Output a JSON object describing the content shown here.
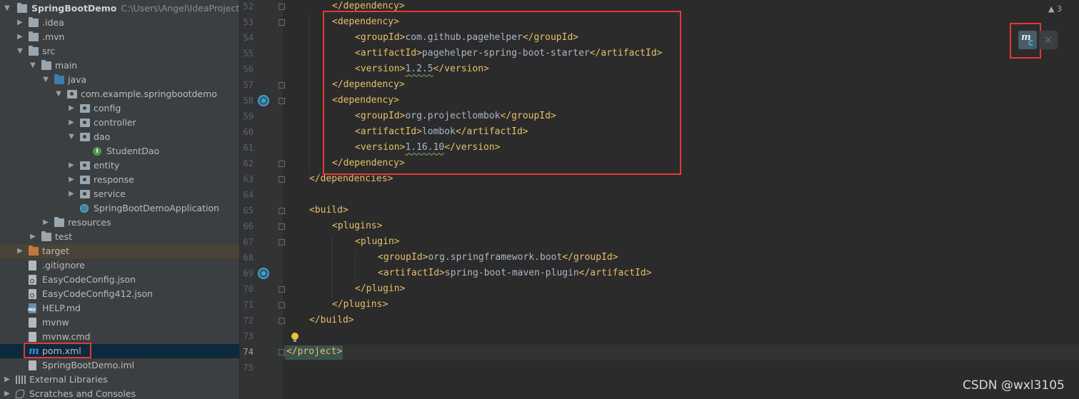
{
  "project": {
    "name": "SpringBootDemo",
    "path": "C:\\Users\\Angel\\IdeaProjects\\Sp"
  },
  "tree": [
    {
      "label": ".idea",
      "icon": "folder-icon",
      "arrow": "right"
    },
    {
      "label": ".mvn",
      "icon": "folder-icon",
      "arrow": "right"
    },
    {
      "label": "src",
      "icon": "folder-icon",
      "arrow": "down"
    },
    {
      "label": "main",
      "icon": "folder-icon",
      "arrow": "down"
    },
    {
      "label": "java",
      "icon": "source-folder-icon",
      "arrow": "down"
    },
    {
      "label": "com.example.springbootdemo",
      "icon": "package-icon",
      "arrow": "down"
    },
    {
      "label": "config",
      "icon": "package-icon",
      "arrow": "right"
    },
    {
      "label": "controller",
      "icon": "package-icon",
      "arrow": "right"
    },
    {
      "label": "dao",
      "icon": "package-icon",
      "arrow": "down"
    },
    {
      "label": "StudentDao",
      "icon": "interface-icon",
      "arrow": ""
    },
    {
      "label": "entity",
      "icon": "package-icon",
      "arrow": "right"
    },
    {
      "label": "response",
      "icon": "package-icon",
      "arrow": "right"
    },
    {
      "label": "service",
      "icon": "package-icon",
      "arrow": "right"
    },
    {
      "label": "SpringBootDemoApplication",
      "icon": "spring-class-icon",
      "arrow": ""
    },
    {
      "label": "resources",
      "icon": "resources-folder-icon",
      "arrow": "right"
    },
    {
      "label": "test",
      "icon": "folder-icon",
      "arrow": "right"
    },
    {
      "label": "target",
      "icon": "excluded-folder-icon",
      "arrow": "right"
    },
    {
      "label": ".gitignore",
      "icon": "file-icon",
      "arrow": ""
    },
    {
      "label": "EasyCodeConfig.json",
      "icon": "config-file-icon",
      "arrow": ""
    },
    {
      "label": "EasyCodeConfig412.json",
      "icon": "config-file-icon",
      "arrow": ""
    },
    {
      "label": "HELP.md",
      "icon": "markdown-file-icon",
      "arrow": ""
    },
    {
      "label": "mvnw",
      "icon": "file-icon",
      "arrow": ""
    },
    {
      "label": "mvnw.cmd",
      "icon": "file-icon",
      "arrow": ""
    },
    {
      "label": "pom.xml",
      "icon": "maven-icon",
      "arrow": ""
    },
    {
      "label": "SpringBootDemo.iml",
      "icon": "file-icon",
      "arrow": ""
    },
    {
      "label": "External Libraries",
      "icon": "libraries-icon",
      "arrow": "right"
    },
    {
      "label": "Scratches and Consoles",
      "icon": "scratches-icon",
      "arrow": "right"
    }
  ],
  "editor": {
    "lines": [
      {
        "n": "52",
        "tokens": [
          {
            "t": "tag",
            "v": "</dependency>"
          }
        ]
      },
      {
        "n": "53",
        "tokens": [
          {
            "t": "tag",
            "v": "<dependency>"
          }
        ]
      },
      {
        "n": "54",
        "tokens": [
          {
            "t": "tag",
            "v": "<groupId>"
          },
          {
            "t": "txt",
            "v": "com.github.pagehelper"
          },
          {
            "t": "tag",
            "v": "</groupId>"
          }
        ]
      },
      {
        "n": "55",
        "tokens": [
          {
            "t": "tag",
            "v": "<artifactId>"
          },
          {
            "t": "txt",
            "v": "pagehelper-spring-boot-starter"
          },
          {
            "t": "tag",
            "v": "</artifactId>"
          }
        ]
      },
      {
        "n": "56",
        "tokens": [
          {
            "t": "tag",
            "v": "<version>"
          },
          {
            "t": "sq",
            "v": "1.2.5"
          },
          {
            "t": "tag",
            "v": "</version>"
          }
        ]
      },
      {
        "n": "57",
        "tokens": [
          {
            "t": "tag",
            "v": "</dependency>"
          }
        ]
      },
      {
        "n": "58",
        "tokens": [
          {
            "t": "tag",
            "v": "<dependency>"
          }
        ]
      },
      {
        "n": "59",
        "tokens": [
          {
            "t": "tag",
            "v": "<groupId>"
          },
          {
            "t": "txt",
            "v": "org.projectlombok"
          },
          {
            "t": "tag",
            "v": "</groupId>"
          }
        ]
      },
      {
        "n": "60",
        "tokens": [
          {
            "t": "tag",
            "v": "<artifactId>"
          },
          {
            "t": "txt",
            "v": "lombok"
          },
          {
            "t": "tag",
            "v": "</artifactId>"
          }
        ]
      },
      {
        "n": "61",
        "tokens": [
          {
            "t": "tag",
            "v": "<version>"
          },
          {
            "t": "sq",
            "v": "1.16.10"
          },
          {
            "t": "tag",
            "v": "</version>"
          }
        ]
      },
      {
        "n": "62",
        "tokens": [
          {
            "t": "tag",
            "v": "</dependency>"
          }
        ]
      },
      {
        "n": "63",
        "tokens": [
          {
            "t": "tag",
            "v": "</dependencies>"
          }
        ]
      },
      {
        "n": "64",
        "tokens": []
      },
      {
        "n": "65",
        "tokens": [
          {
            "t": "tag",
            "v": "<build>"
          }
        ]
      },
      {
        "n": "66",
        "tokens": [
          {
            "t": "tag",
            "v": "<plugins>"
          }
        ]
      },
      {
        "n": "67",
        "tokens": [
          {
            "t": "tag",
            "v": "<plugin>"
          }
        ]
      },
      {
        "n": "68",
        "tokens": [
          {
            "t": "tag",
            "v": "<groupId>"
          },
          {
            "t": "txt",
            "v": "org.springframework.boot"
          },
          {
            "t": "tag",
            "v": "</groupId>"
          }
        ]
      },
      {
        "n": "69",
        "tokens": [
          {
            "t": "tag",
            "v": "<artifactId>"
          },
          {
            "t": "txt",
            "v": "spring-boot-maven-plugin"
          },
          {
            "t": "tag",
            "v": "</artifactId>"
          }
        ]
      },
      {
        "n": "70",
        "tokens": [
          {
            "t": "tag",
            "v": "</plugin>"
          }
        ]
      },
      {
        "n": "71",
        "tokens": [
          {
            "t": "tag",
            "v": "</plugins>"
          }
        ]
      },
      {
        "n": "72",
        "tokens": [
          {
            "t": "tag",
            "v": "</build>"
          }
        ]
      },
      {
        "n": "73",
        "tokens": []
      },
      {
        "n": "74",
        "tokens": [
          {
            "t": "tag",
            "v": "</project>"
          }
        ]
      },
      {
        "n": "75",
        "tokens": []
      }
    ]
  },
  "toolbar": {
    "warnings_count": "3",
    "maven_reload_icon": "maven-reload-icon",
    "close_symbol": "×"
  },
  "watermark": "CSDN @wxl3105",
  "colors": {
    "tag": "#e8bf6a",
    "text": "#a9b7c6",
    "highlight_box": "#e53935",
    "selection": "#0d293e"
  }
}
